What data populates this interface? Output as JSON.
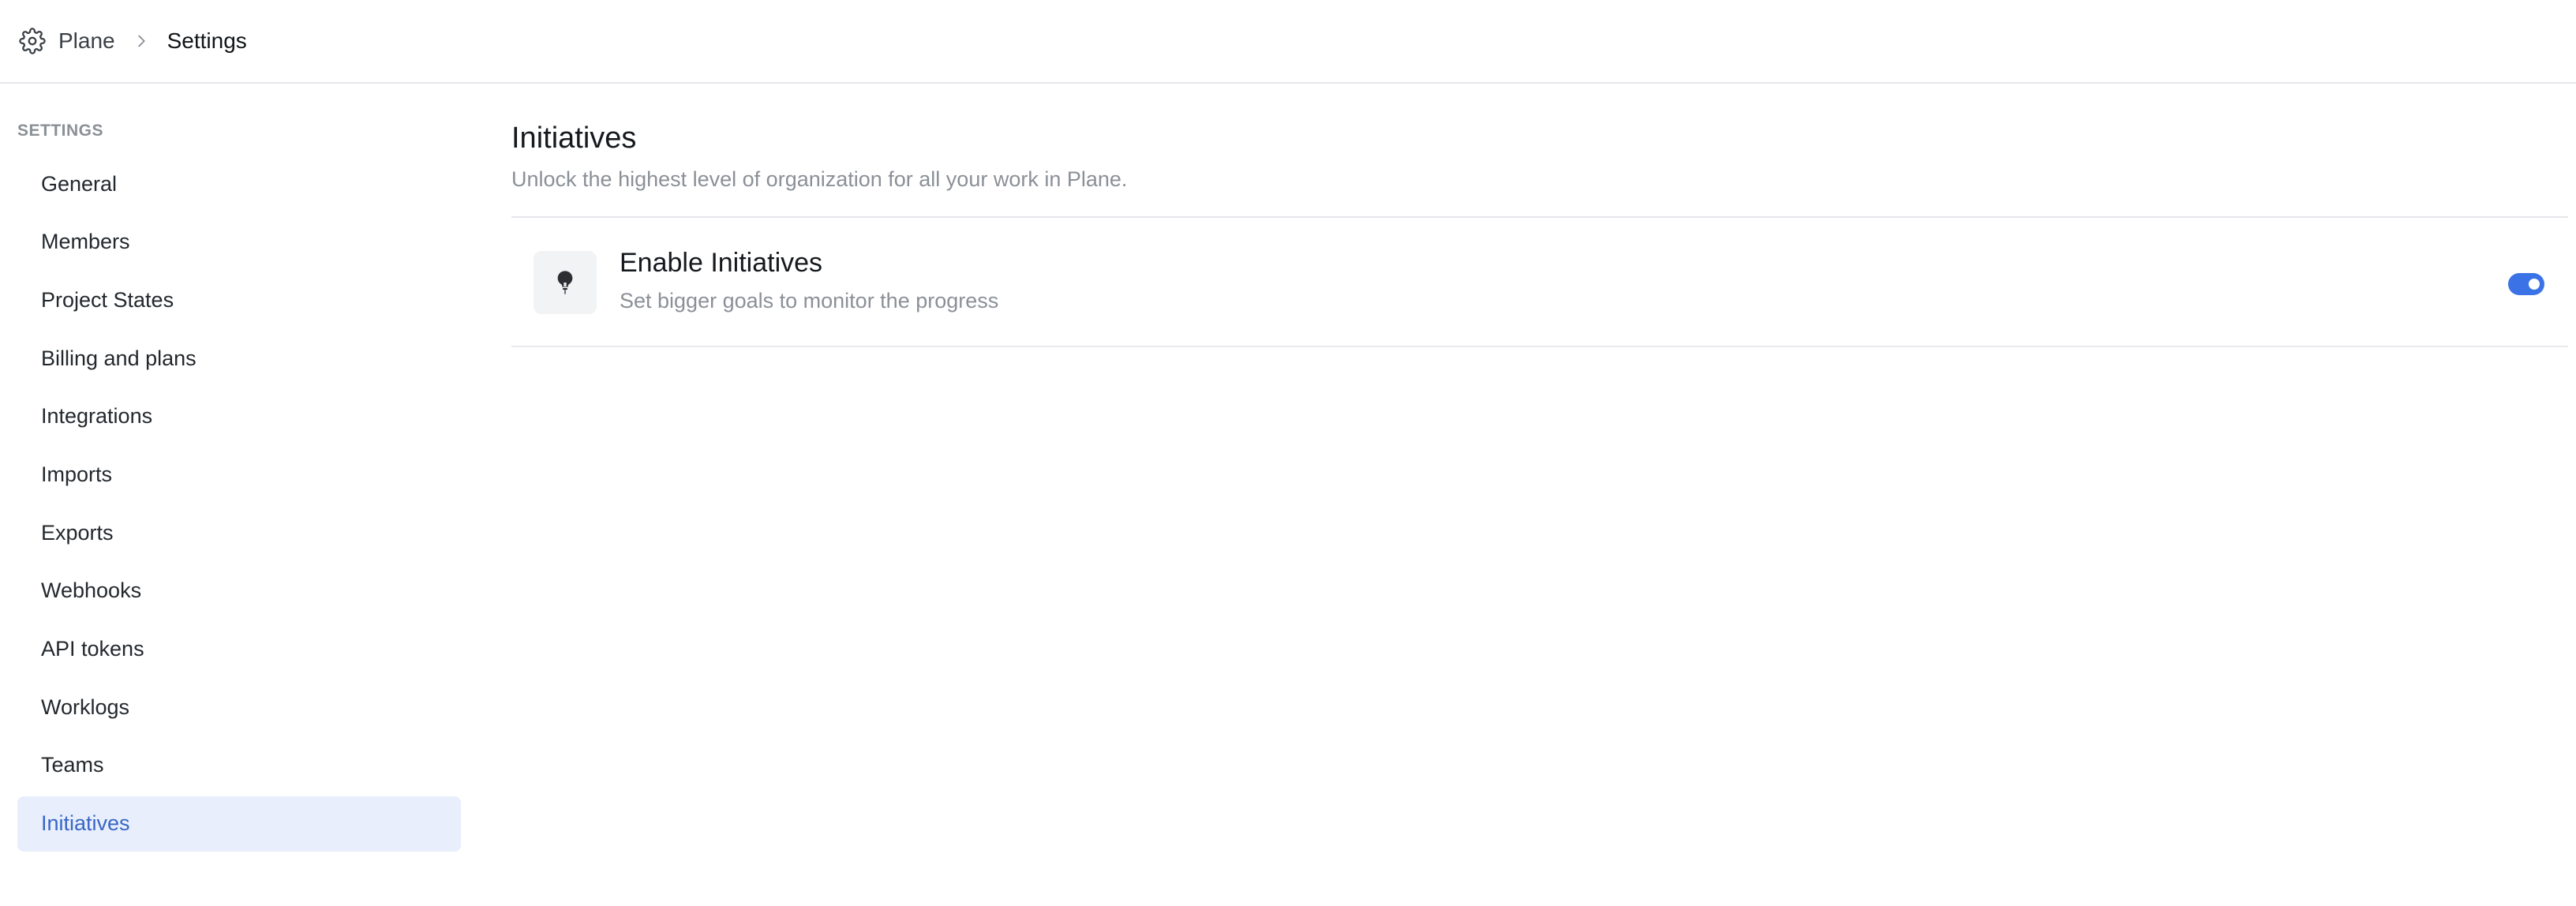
{
  "breadcrumb": {
    "root_icon": "gear-icon",
    "root": "Plane",
    "separator_icon": "chevron-right-icon",
    "current": "Settings"
  },
  "sidebar": {
    "heading": "SETTINGS",
    "items": [
      {
        "label": "General",
        "active": false
      },
      {
        "label": "Members",
        "active": false
      },
      {
        "label": "Project States",
        "active": false
      },
      {
        "label": "Billing and plans",
        "active": false
      },
      {
        "label": "Integrations",
        "active": false
      },
      {
        "label": "Imports",
        "active": false
      },
      {
        "label": "Exports",
        "active": false
      },
      {
        "label": "Webhooks",
        "active": false
      },
      {
        "label": "API tokens",
        "active": false
      },
      {
        "label": "Worklogs",
        "active": false
      },
      {
        "label": "Teams",
        "active": false
      },
      {
        "label": "Initiatives",
        "active": true
      }
    ]
  },
  "main": {
    "title": "Initiatives",
    "subtitle": "Unlock the highest level of organization for all your work in Plane.",
    "feature": {
      "icon": "lightbulb-icon",
      "title": "Enable Initiatives",
      "description": "Set bigger goals to monitor the progress",
      "enabled": true
    }
  },
  "colors": {
    "accent": "#3b73e6",
    "active_bg": "#e8eefb",
    "active_text": "#3767c6"
  }
}
